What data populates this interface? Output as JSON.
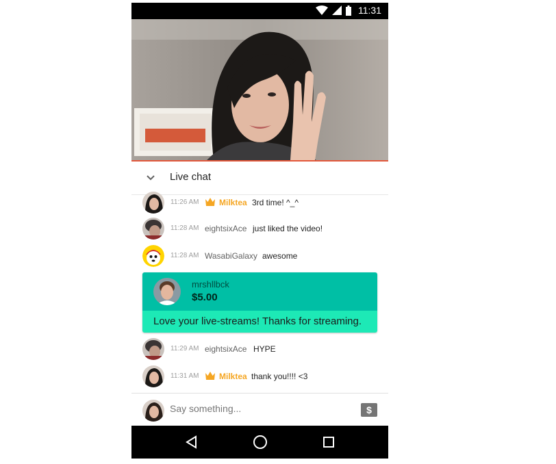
{
  "status_bar": {
    "time": "11:31",
    "icons": [
      "wifi-icon",
      "cellular-signal-icon",
      "battery-icon"
    ]
  },
  "video": {
    "description_icon": "live-video-frame"
  },
  "chat_header": {
    "title": "Live chat",
    "collapse_icon": "chevron-down-icon"
  },
  "messages": [
    {
      "time": "11:26 AM",
      "author": "Milktea",
      "owner": true,
      "text": "3rd time! ^_^"
    },
    {
      "time": "11:28 AM",
      "author": "eightsixAce",
      "owner": false,
      "text": "just liked the video!"
    },
    {
      "time": "11:28 AM",
      "author": "WasabiGalaxy",
      "owner": false,
      "text": "awesome"
    },
    {
      "time": "11:29 AM",
      "author": "eightsixAce",
      "owner": false,
      "text": "HYPE"
    },
    {
      "time": "11:31 AM",
      "author": "Milktea",
      "owner": true,
      "text": "thank you!!!! <3"
    }
  ],
  "superchat": {
    "author": "mrshllbck",
    "amount": "$5.00",
    "message": "Love your live-streams! Thanks for streaming."
  },
  "input": {
    "placeholder": "Say something...",
    "donate_icon": "dollar-icon"
  },
  "nav_bar": {
    "icons": [
      "back-icon",
      "home-icon",
      "recents-icon"
    ]
  },
  "colors": {
    "owner_gold": "#f5a623",
    "superchat_top": "#00bfa5",
    "superchat_bottom": "#1de9b6",
    "accent_line": "#e4573b"
  }
}
